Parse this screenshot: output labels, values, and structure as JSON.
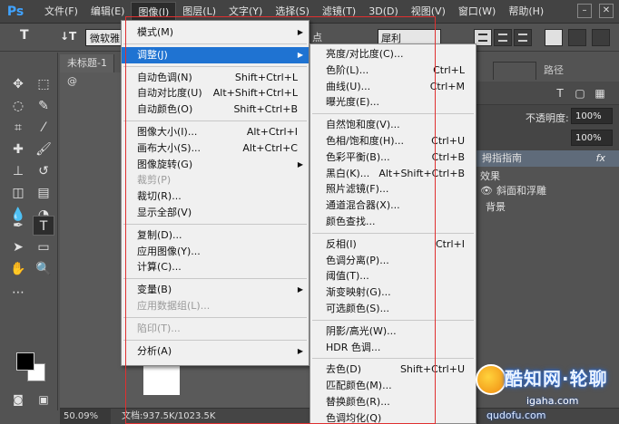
{
  "app": {
    "logo": "Ps"
  },
  "menubar": {
    "items": [
      "文件(F)",
      "编辑(E)",
      "图像(I)",
      "图层(L)",
      "文字(Y)",
      "选择(S)",
      "滤镜(T)",
      "3D(D)",
      "视图(V)",
      "窗口(W)",
      "帮助(H)"
    ],
    "active": "图像(I)"
  },
  "window_controls": {
    "minimize": "–",
    "restore": "□",
    "close": "✕"
  },
  "options_bar": {
    "tool_glyph": "T",
    "orient_glyph": "↓T",
    "font_family": "微软雅",
    "size_suffix": "点",
    "anti_alias": "犀利"
  },
  "document": {
    "tab_label": "未标题-1 @",
    "zoom": "50.09%",
    "doc_size": "文档:937.5K/1023.5K"
  },
  "right_panel": {
    "tabs": [
      "",
      "路径"
    ],
    "opacity_label": "不透明度:",
    "opacity_value": "100%",
    "fill_value": "100%",
    "effects_header": "拇指指南",
    "fx": "fx",
    "effects_label": "效果",
    "bevel_label": "斜面和浮雕",
    "background_label": "背景"
  },
  "image_menu": [
    {
      "label": "模式(M)",
      "submenu": true
    },
    {
      "separator": true
    },
    {
      "label": "调整(J)",
      "submenu": true,
      "highlighted": true
    },
    {
      "separator": true
    },
    {
      "label": "自动色调(N)",
      "shortcut": "Shift+Ctrl+L"
    },
    {
      "label": "自动对比度(U)",
      "shortcut": "Alt+Shift+Ctrl+L"
    },
    {
      "label": "自动颜色(O)",
      "shortcut": "Shift+Ctrl+B"
    },
    {
      "separator": true
    },
    {
      "label": "图像大小(I)...",
      "shortcut": "Alt+Ctrl+I"
    },
    {
      "label": "画布大小(S)...",
      "shortcut": "Alt+Ctrl+C"
    },
    {
      "label": "图像旋转(G)",
      "submenu": true
    },
    {
      "label": "裁剪(P)",
      "disabled": true
    },
    {
      "label": "裁切(R)..."
    },
    {
      "label": "显示全部(V)"
    },
    {
      "separator": true
    },
    {
      "label": "复制(D)..."
    },
    {
      "label": "应用图像(Y)..."
    },
    {
      "label": "计算(C)..."
    },
    {
      "separator": true
    },
    {
      "label": "变量(B)",
      "submenu": true
    },
    {
      "label": "应用数据组(L)...",
      "disabled": true
    },
    {
      "separator": true
    },
    {
      "label": "陷印(T)...",
      "disabled": true
    },
    {
      "separator": true
    },
    {
      "label": "分析(A)",
      "submenu": true
    }
  ],
  "adjust_menu": [
    {
      "label": "亮度/对比度(C)..."
    },
    {
      "label": "色阶(L)...",
      "shortcut": "Ctrl+L"
    },
    {
      "label": "曲线(U)...",
      "shortcut": "Ctrl+M"
    },
    {
      "label": "曝光度(E)..."
    },
    {
      "separator": true
    },
    {
      "label": "自然饱和度(V)..."
    },
    {
      "label": "色相/饱和度(H)...",
      "shortcut": "Ctrl+U"
    },
    {
      "label": "色彩平衡(B)...",
      "shortcut": "Ctrl+B"
    },
    {
      "label": "黑白(K)...",
      "shortcut": "Alt+Shift+Ctrl+B"
    },
    {
      "label": "照片滤镜(F)..."
    },
    {
      "label": "通道混合器(X)..."
    },
    {
      "label": "颜色查找..."
    },
    {
      "separator": true
    },
    {
      "label": "反相(I)",
      "shortcut": "Ctrl+I"
    },
    {
      "label": "色调分离(P)..."
    },
    {
      "label": "阈值(T)..."
    },
    {
      "label": "渐变映射(G)..."
    },
    {
      "label": "可选颜色(S)..."
    },
    {
      "separator": true
    },
    {
      "label": "阴影/高光(W)..."
    },
    {
      "label": "HDR 色调..."
    },
    {
      "separator": true
    },
    {
      "label": "去色(D)",
      "shortcut": "Shift+Ctrl+U"
    },
    {
      "label": "匹配颜色(M)..."
    },
    {
      "label": "替换颜色(R)..."
    },
    {
      "label": "色调均化(Q)"
    }
  ],
  "watermark": {
    "title": "酷知网",
    "title2": "·轮聊",
    "site": "igaha.com",
    "bottom": "qudofu.com"
  },
  "colors": {
    "menu_highlight": "#1f73d2",
    "annotation_red": "#e03030",
    "ps_blue": "#40a3ff"
  }
}
